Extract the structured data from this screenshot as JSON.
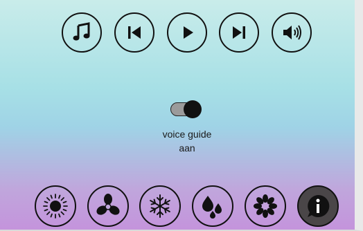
{
  "media_controls": [
    {
      "name": "music-button",
      "icon": "music-note-icon"
    },
    {
      "name": "previous-button",
      "icon": "skip-previous-icon"
    },
    {
      "name": "play-button",
      "icon": "play-icon"
    },
    {
      "name": "next-button",
      "icon": "skip-next-icon"
    },
    {
      "name": "volume-button",
      "icon": "volume-icon"
    }
  ],
  "voice_guide": {
    "label": "voice guide",
    "state": "aan",
    "enabled": true
  },
  "bottom_controls": [
    {
      "name": "brightness-button",
      "icon": "sun-icon"
    },
    {
      "name": "fan-button",
      "icon": "fan-icon"
    },
    {
      "name": "cooling-button",
      "icon": "snowflake-icon"
    },
    {
      "name": "humidity-button",
      "icon": "water-drops-icon"
    },
    {
      "name": "flower-button",
      "icon": "flower-icon"
    },
    {
      "name": "info-button",
      "icon": "info-icon"
    }
  ],
  "colors": {
    "gradient_top": "#c9ecea",
    "gradient_middle": "#9fd3e6",
    "gradient_bottom": "#c493dc",
    "icon_stroke": "#111111",
    "toggle_track": "#9b9b9b",
    "info_fill": "#4a4648"
  }
}
